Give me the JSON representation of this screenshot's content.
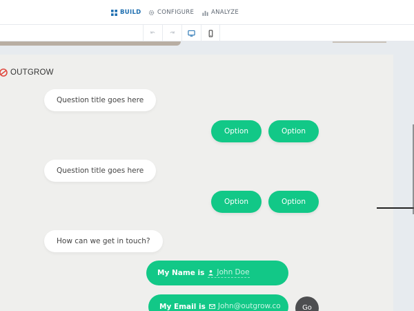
{
  "nav": {
    "tabs": [
      {
        "label": "BUILD",
        "icon": "grid-icon",
        "active": true
      },
      {
        "label": "CONFIGURE",
        "icon": "gear-icon",
        "active": false
      },
      {
        "label": "ANALYZE",
        "icon": "bar-chart-icon",
        "active": false
      }
    ]
  },
  "toolbar": {
    "tools": [
      "undo-icon",
      "redo-icon",
      "desktop-icon",
      "mobile-icon"
    ],
    "active_view": "desktop"
  },
  "brand": {
    "logo_text": "OUTGROW",
    "accent": "#e0483e"
  },
  "chat": {
    "q1": "Question title goes here",
    "q1_options": [
      "Option",
      "Option"
    ],
    "q2": "Question title goes here",
    "q2_options": [
      "Option",
      "Option"
    ],
    "q3": "How can we get in touch?",
    "name_label": "My Name is",
    "name_placeholder": "John Doe",
    "email_label": "My Email is",
    "email_placeholder": "John@outgrow.co",
    "go_label": "Go"
  },
  "colors": {
    "option_green": "#12c887",
    "active_tab": "#1f6fb0",
    "panel_bg": "#efefed"
  }
}
